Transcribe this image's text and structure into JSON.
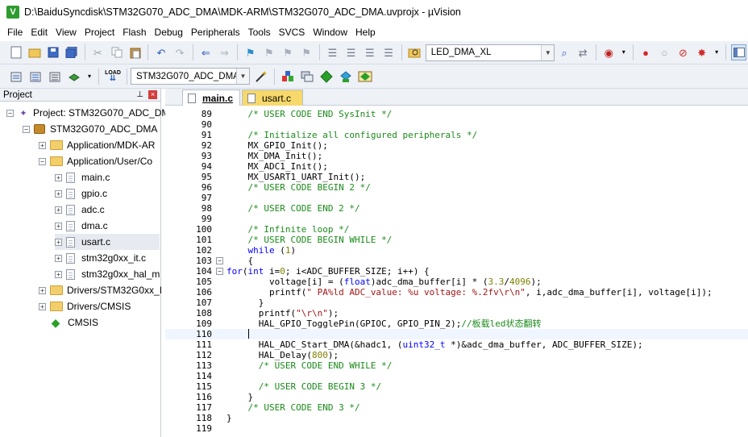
{
  "window": {
    "title": "D:\\BaiduSyncdisk\\STM32G070_ADC_DMA\\MDK-ARM\\STM32G070_ADC_DMA.uvprojx - µVision"
  },
  "menu": [
    "File",
    "Edit",
    "View",
    "Project",
    "Flash",
    "Debug",
    "Peripherals",
    "Tools",
    "SVCS",
    "Window",
    "Help"
  ],
  "toolbar1": {
    "target_combo": "LED_DMA_XL"
  },
  "toolbar2": {
    "target_select": "STM32G070_ADC_DMA"
  },
  "project_panel": {
    "title": "Project",
    "root": "Project: STM32G070_ADC_DM",
    "target": "STM32G070_ADC_DMA",
    "groups": {
      "app_mdk": "Application/MDK-AR",
      "app_user": "Application/User/Co",
      "drivers_hal": "Drivers/STM32G0xx_I",
      "drivers_cmsis": "Drivers/CMSIS",
      "cmsis": "CMSIS"
    },
    "files": [
      "main.c",
      "gpio.c",
      "adc.c",
      "dma.c",
      "usart.c",
      "stm32g0xx_it.c",
      "stm32g0xx_hal_m"
    ]
  },
  "editor": {
    "tabs": [
      "main.c",
      "usart.c"
    ],
    "active_tab": "main.c",
    "lines": [
      {
        "n": "89",
        "t": "    /* USER CODE END SysInit */"
      },
      {
        "n": "90",
        "t": ""
      },
      {
        "n": "91",
        "t": "    /* Initialize all configured peripherals */"
      },
      {
        "n": "92",
        "t": "    MX_GPIO_Init();"
      },
      {
        "n": "93",
        "t": "    MX_DMA_Init();"
      },
      {
        "n": "94",
        "t": "    MX_ADC1_Init();"
      },
      {
        "n": "95",
        "t": "    MX_USART1_UART_Init();"
      },
      {
        "n": "96",
        "t": "    /* USER CODE BEGIN 2 */"
      },
      {
        "n": "97",
        "t": ""
      },
      {
        "n": "98",
        "t": "    /* USER CODE END 2 */"
      },
      {
        "n": "99",
        "t": ""
      },
      {
        "n": "100",
        "t": "    /* Infinite loop */"
      },
      {
        "n": "101",
        "t": "    /* USER CODE BEGIN WHILE */"
      },
      {
        "n": "102",
        "t": "    while (1)"
      },
      {
        "n": "103",
        "t": "    {"
      },
      {
        "n": "104",
        "t": "for(int i=0; i<ADC_BUFFER_SIZE; i++) {"
      },
      {
        "n": "105",
        "t": "        voltage[i] = (float)adc_dma_buffer[i] * (3.3/4096);"
      },
      {
        "n": "106",
        "t": "        printf(\" PA%ld ADC_value: %u voltage: %.2fv\\r\\n\", i,adc_dma_buffer[i], voltage[i]);"
      },
      {
        "n": "107",
        "t": "      }"
      },
      {
        "n": "108",
        "t": "      printf(\"\\r\\n\");"
      },
      {
        "n": "109",
        "t": "      HAL_GPIO_TogglePin(GPIOC, GPIO_PIN_2);//板载led状态翻转"
      },
      {
        "n": "110",
        "t": ""
      },
      {
        "n": "111",
        "t": "      HAL_ADC_Start_DMA(&hadc1, (uint32_t *)&adc_dma_buffer, ADC_BUFFER_SIZE);"
      },
      {
        "n": "112",
        "t": "      HAL_Delay(800);"
      },
      {
        "n": "113",
        "t": "      /* USER CODE END WHILE */"
      },
      {
        "n": "114",
        "t": ""
      },
      {
        "n": "115",
        "t": "      /* USER CODE BEGIN 3 */"
      },
      {
        "n": "116",
        "t": "    }"
      },
      {
        "n": "117",
        "t": "    /* USER CODE END 3 */"
      },
      {
        "n": "118",
        "t": "}"
      },
      {
        "n": "119",
        "t": ""
      }
    ]
  }
}
